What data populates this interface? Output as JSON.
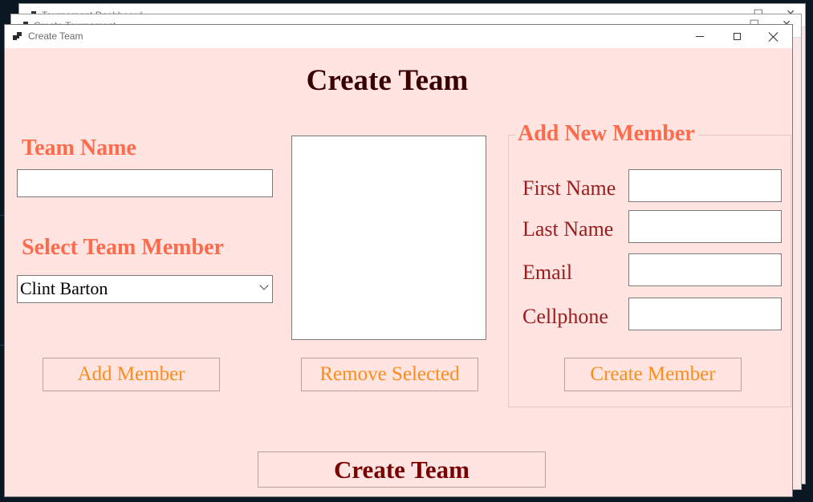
{
  "window": {
    "title": "Create Team"
  },
  "background_windows": [
    {
      "title": "Tournament Dashboard"
    },
    {
      "title": "Create Tournament"
    }
  ],
  "form": {
    "heading": "Create Team",
    "team_name_label": "Team Name",
    "team_name_value": "",
    "select_member_label": "Select Team Member",
    "select_member_value": "Clint Barton",
    "add_member_button": "Add Member",
    "remove_selected_button": "Remove Selected",
    "create_team_button": "Create Team"
  },
  "new_member": {
    "group_label": "Add New Member",
    "first_name_label": "First Name",
    "last_name_label": "Last Name",
    "email_label": "Email",
    "cellphone_label": "Cellphone",
    "first_name_value": "",
    "last_name_value": "",
    "email_value": "",
    "cellphone_value": "",
    "create_member_button": "Create Member"
  },
  "colors": {
    "form_background": "#ffe4e1",
    "heading": "#3a0000",
    "label": "#ff6a4a",
    "field_label": "#9b1c1c",
    "button_text": "#ff8c1a",
    "primary_button_text": "#7a0000"
  }
}
